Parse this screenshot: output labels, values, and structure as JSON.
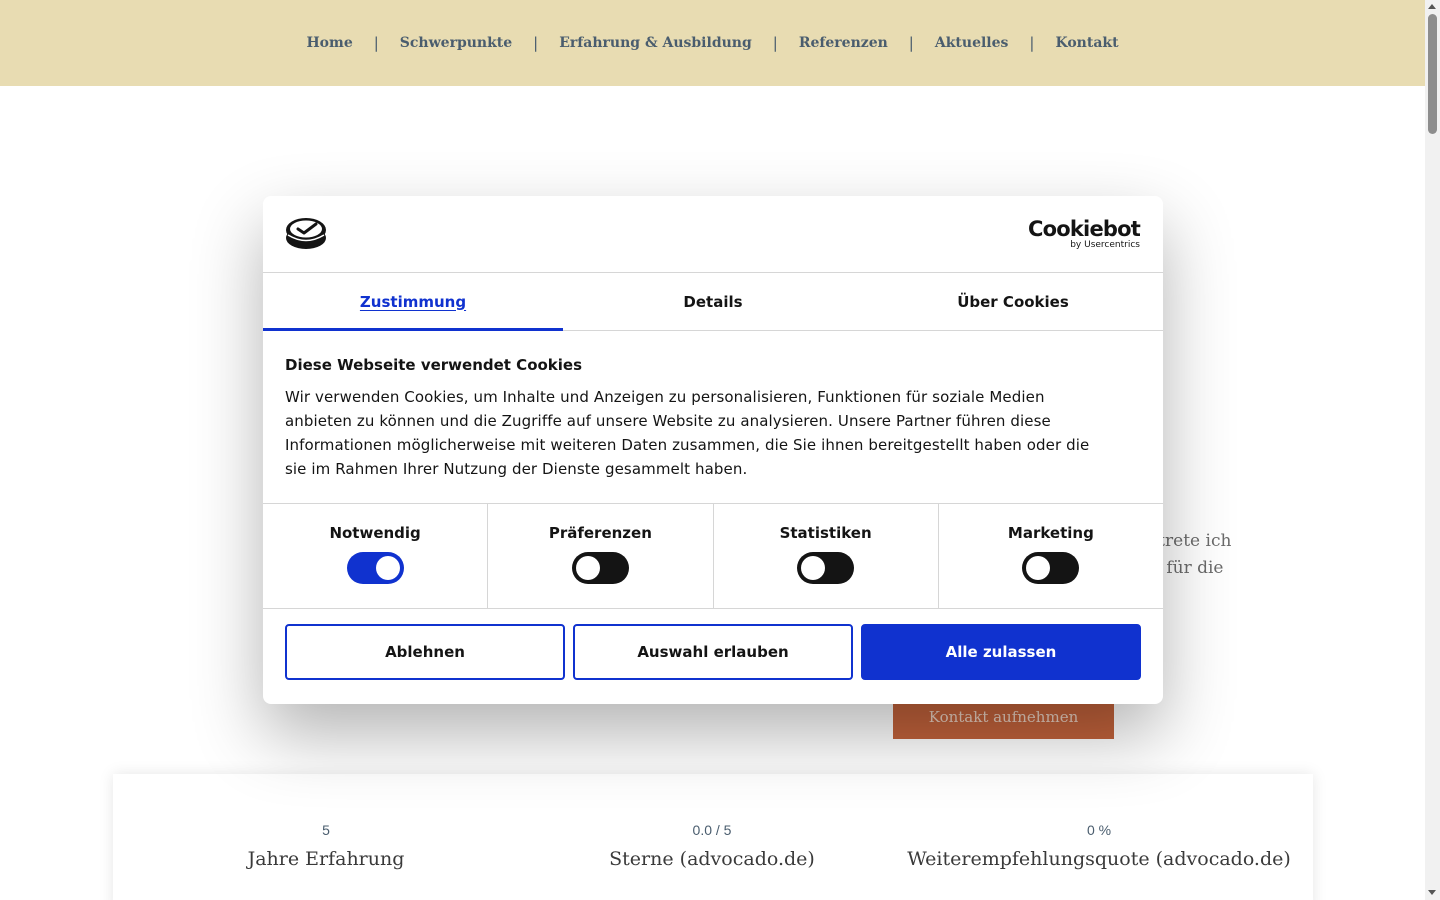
{
  "nav": {
    "items": [
      "Home",
      "Schwerpunkte",
      "Erfahrung & Ausbildung",
      "Referenzen",
      "Aktuelles",
      "Kontakt"
    ],
    "separator": "|"
  },
  "hero": {
    "text_line1": "ertrete ich",
    "text_line2": "ge für die",
    "cta_label": "Kontakt aufnehmen",
    "cta_color": "#c1623b"
  },
  "stats": [
    {
      "number": "5",
      "label": "Jahre Erfahrung"
    },
    {
      "number": "0.0 / 5",
      "label": "Sterne (advocado.de)"
    },
    {
      "number": "0 %",
      "label": "Weiterempfehlungsquote (advocado.de)"
    }
  ],
  "cookie": {
    "brand_name": "Cookiebot",
    "brand_by": "by Usercentrics",
    "tabs": [
      "Zustimmung",
      "Details",
      "Über Cookies"
    ],
    "active_tab": "Zustimmung",
    "title": "Diese Webseite verwendet Cookies",
    "text_lines": [
      "Wir verwenden Cookies, um Inhalte und Anzeigen zu personalisieren, Funktionen für soziale Medien",
      "anbieten zu können und die Zugriffe auf unsere Website zu analysieren. Unsere Partner führen diese",
      "Informationen möglicherweise mit weiteren Daten zusammen, die Sie ihnen bereitgestellt haben oder die",
      "sie im Rahmen Ihrer Nutzung der Dienste gesammelt haben."
    ],
    "toggles": [
      {
        "label": "Notwendig",
        "on": true
      },
      {
        "label": "Präferenzen",
        "on": false
      },
      {
        "label": "Statistiken",
        "on": false
      },
      {
        "label": "Marketing",
        "on": false
      }
    ],
    "buttons": {
      "decline": "Ablehnen",
      "allow_selection": "Auswahl erlauben",
      "allow_all": "Alle zulassen"
    },
    "accent_color": "#1032cf"
  },
  "colors": {
    "nav_bg": "#e8dcb2",
    "nav_text": "#4a5d6e"
  }
}
